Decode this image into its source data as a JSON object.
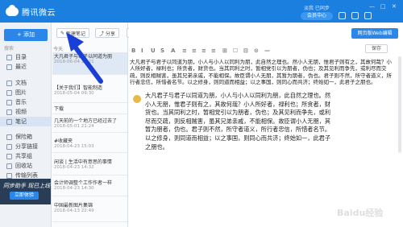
{
  "app": {
    "title": "腾讯微云",
    "account": "淡我 已同步",
    "vip_label": "会员中心",
    "window_controls": [
      "—",
      "□",
      "✕"
    ]
  },
  "sidebar": {
    "add_label": "+ 添加",
    "search_placeholder": "搜索",
    "items": [
      {
        "label": "目录",
        "icon": "folder-icon"
      },
      {
        "label": "最近",
        "icon": "clock-icon"
      },
      {
        "label": "文档",
        "icon": "doc-icon"
      },
      {
        "label": "图片",
        "icon": "image-icon"
      },
      {
        "label": "音乐",
        "icon": "music-icon"
      },
      {
        "label": "视频",
        "icon": "video-icon"
      },
      {
        "label": "笔记",
        "icon": "note-icon"
      },
      {
        "label": "保险箱",
        "icon": "safe-icon"
      },
      {
        "label": "分享链接",
        "icon": "share-icon"
      },
      {
        "label": "共享组",
        "icon": "group-icon"
      },
      {
        "label": "回收站",
        "icon": "trash-icon"
      },
      {
        "label": "传输列表",
        "icon": "transfer-icon"
      }
    ],
    "promo_text": "同步助手 现已上线",
    "promo_button": "立即体验"
  },
  "toolbar": {
    "new_note": "新建笔记",
    "share": "分享",
    "delete": "删除",
    "web_edit": "网页版Web编辑"
  },
  "list": {
    "section": "今天",
    "notes": [
      {
        "title": "大凡君子与君子以同道为朋",
        "date": "2018-06-04 15:21"
      },
      {
        "title": "【关于我们】智能制造",
        "date": "2018-05-04 09:30"
      },
      {
        "title": "下载",
        "date": ""
      },
      {
        "title": "几天前的一个地方已经过去了",
        "date": "2018-05-01 21:24"
      },
      {
        "title": "#收藏夹",
        "date": "2018-04-23 15:03"
      },
      {
        "title": "闲谈 | 生活中有意思的事情",
        "date": "2018-04-23 14:32"
      },
      {
        "title": "会计师调整个工作作者一样",
        "date": "2018-04-23 14:30"
      },
      {
        "title": "中国最新图片集锦",
        "date": "2018-04-13 22:49"
      }
    ]
  },
  "editor": {
    "save_label": "保存",
    "format_buttons": [
      "B",
      "I",
      "U",
      "S",
      "A",
      "≡",
      "≡",
      "≡",
      "≡",
      "⊞",
      "☐",
      "⊟",
      "⊙",
      "—"
    ],
    "paragraph1": "大凡君子与君子以同道为朋，小人与小人以同利为朋，此自然之理也。然小人无朋，惟君子则有之，其故何哉？小人所好者，禄利也；所贪者，财货也。当其同利之时，暂相党引以为朋者，伪也；及其见利而争先，或利尽而交疏，则反相贼害，虽其兄弟亲戚，不能相保。故臣谓小人无朋，其暂为朋者，伪也。君子则不然，所守者道义，所行者忠信，所惜者名节。以之修身，则同道而相益；以之事国，则同心而共济；终始如一，此君子之朋也。",
    "paragraph2": "大凡君子与君子以同道为朋，小人与小人以同利为朋，此自然之理也。然小人无朋，惟君子则有之，其故何哉？小人所好者，禄利也；所贪者，财货也。当其同利之时，暂相党引以为朋者，伪也；及其见利而争先，或利尽而交疏，则反相贼害，虽其兄弟亲戚，不能相保。故臣谓小人无朋，其暂为朋者，伪也。君子则不然，所守者道义，所行者忠信，所惜者名节。以之修身，则同道而相益；以之事国，则同心而共济；终始如一，此君子之朋也。"
  },
  "colors": {
    "titlebar": "#1b7fe0",
    "accent": "#2a86e8",
    "arrow": "#1a3fd6"
  }
}
